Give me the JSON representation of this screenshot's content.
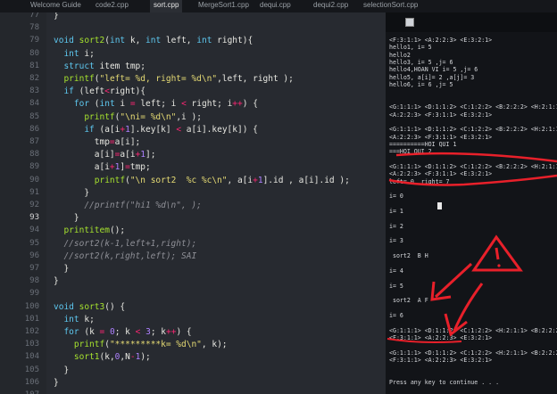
{
  "tabs": [
    {
      "label": "Welcome Guide",
      "active": false
    },
    {
      "label": "code2.cpp",
      "active": false
    },
    {
      "label": "sort.cpp",
      "active": true
    },
    {
      "label": "MergeSort1.cpp",
      "active": false
    },
    {
      "label": "dequi.cpp",
      "active": false
    },
    {
      "label": "dequi2.cpp",
      "active": false
    },
    {
      "label": "selectionSort.cpp",
      "active": false
    }
  ],
  "editor": {
    "current_line": "93",
    "lines": [
      {
        "n": "77",
        "text": "}"
      },
      {
        "n": "78",
        "text": ""
      },
      {
        "n": "79",
        "text": "void sort2(int k, int left, int right){"
      },
      {
        "n": "80",
        "text": "  int i;"
      },
      {
        "n": "81",
        "text": "  struct item tmp;"
      },
      {
        "n": "82",
        "text": "  printf(\"left= %d, right= %d\\n\",left, right );"
      },
      {
        "n": "83",
        "text": "  if (left<right){"
      },
      {
        "n": "84",
        "text": "    for (int i = left; i < right; i++) {"
      },
      {
        "n": "85",
        "text": "      printf(\"\\ni= %d\\n\",i );"
      },
      {
        "n": "86",
        "text": "      if (a[i+1].key[k] < a[i].key[k]) {"
      },
      {
        "n": "87",
        "text": "        tmp=a[i];"
      },
      {
        "n": "88",
        "text": "        a[i]=a[i+1];"
      },
      {
        "n": "89",
        "text": "        a[i+1]=tmp;"
      },
      {
        "n": "90",
        "text": "        printf(\"\\n sort2  %c %c\\n\", a[i+1].id , a[i].id );"
      },
      {
        "n": "91",
        "text": "      }"
      },
      {
        "n": "92",
        "text": "      //printf(\"hi1 %d\\n\", );"
      },
      {
        "n": "93",
        "text": "    }"
      },
      {
        "n": "94",
        "text": "  printitem();"
      },
      {
        "n": "95",
        "text": "  //sort2(k-1,left+1,right);"
      },
      {
        "n": "96",
        "text": "  //sort2(k,right,left); SAI"
      },
      {
        "n": "97",
        "text": "  }"
      },
      {
        "n": "98",
        "text": "}"
      },
      {
        "n": "99",
        "text": ""
      },
      {
        "n": "100",
        "text": "void sort3() {"
      },
      {
        "n": "101",
        "text": "  int k;"
      },
      {
        "n": "102",
        "text": "  for (k = 0; k < 3; k++) {"
      },
      {
        "n": "103",
        "text": "    printf(\"*********k= %d\\n\", k);"
      },
      {
        "n": "104",
        "text": "    sort1(k,0,N-1);"
      },
      {
        "n": "105",
        "text": "  }"
      },
      {
        "n": "106",
        "text": "}"
      },
      {
        "n": "107",
        "text": ""
      }
    ]
  },
  "console": {
    "title": "",
    "lines": [
      {
        "t": "<F:3:1:1> <A:2:2:3> <E:3:2:1>"
      },
      {
        "t": "hello1, i= 5"
      },
      {
        "t": "hello2"
      },
      {
        "t": "hello3, i= 5 ,j= 6"
      },
      {
        "t": "hello4,HOAN VI i= 5 ,j= 6"
      },
      {
        "t": "hello5, a[i]= 2 ,a[j]= 3"
      },
      {
        "t": "hello6, i= 6 ,j= 5"
      },
      {
        "t": ""
      },
      {
        "t": ""
      },
      {
        "t": "<G:1:1:1> <D:1:1:2> <C:1:2:2> <B:2:2:2> <H:2:1:1"
      },
      {
        "t": "<A:2:2:3> <F:3:1:1> <E:3:2:1>"
      },
      {
        "t": ""
      },
      {
        "t": "<G:1:1:1> <D:1:1:2> <C:1:2:2> <B:2:2:2> <H:2:1:1"
      },
      {
        "t": "<A:2:2:3> <F:3:1:1> <E:3:2:1>"
      },
      {
        "t": "==========HOI QUI 1"
      },
      {
        "t": "===HOI QUI 2"
      },
      {
        "t": ""
      },
      {
        "t": "<G:1:1:1> <D:1:1:2> <C:1:2:2> <B:2:2:2> <H:2:1:1"
      },
      {
        "t": "<A:2:2:3> <F:3:1:1> <E:3:2:1>"
      },
      {
        "t": "left= 0, right= 7"
      },
      {
        "t": ""
      },
      {
        "t": "i= 0"
      },
      {
        "t": ""
      },
      {
        "t": "i= 1"
      },
      {
        "t": ""
      },
      {
        "t": "i= 2"
      },
      {
        "t": ""
      },
      {
        "t": "i= 3"
      },
      {
        "t": ""
      },
      {
        "t": " sort2  B H"
      },
      {
        "t": ""
      },
      {
        "t": "i= 4"
      },
      {
        "t": ""
      },
      {
        "t": "i= 5"
      },
      {
        "t": ""
      },
      {
        "t": " sort2  A F"
      },
      {
        "t": ""
      },
      {
        "t": "i= 6"
      },
      {
        "t": ""
      },
      {
        "t": "<G:1:1:1> <D:1:1:2> <C:1:2:2> <H:2:1:1> <B:2:2:2>"
      },
      {
        "t": "<F:3:1:1> <A:2:2:3> <E:3:2:1>"
      },
      {
        "t": ""
      },
      {
        "t": "<G:1:1:1> <D:1:1:2> <C:1:2:2> <H:2:1:1> <B:2:2:2>"
      },
      {
        "t": "<F:3:1:1> <A:2:2:3> <E:3:2:1>"
      },
      {
        "t": ""
      },
      {
        "t": ""
      },
      {
        "t": "Press any key to continue . . ."
      }
    ]
  },
  "annotation_mark": "!",
  "colors": {
    "annotation": "#e8202a",
    "background": "#272a30"
  }
}
